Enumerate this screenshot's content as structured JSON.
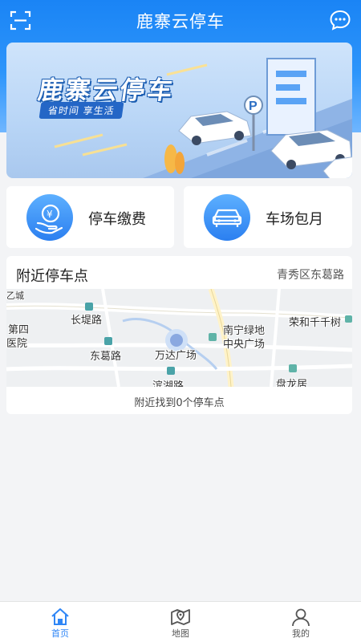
{
  "header": {
    "title": "鹿寨云停车",
    "scan_icon": "scan-icon",
    "message_icon": "message-icon"
  },
  "banner": {
    "title": "鹿寨云停车",
    "slogan": "省时间 享生活",
    "sign_letter": "P"
  },
  "quick_actions": [
    {
      "label": "停车缴费",
      "icon": "yen-hand-icon"
    },
    {
      "label": "车场包月",
      "icon": "car-icon"
    }
  ],
  "nearby": {
    "title": "附近停车点",
    "district": "青秀区东葛路",
    "found_text": "附近找到0个停车点",
    "map_labels": {
      "l1": "长堤路",
      "l2": "东葛路",
      "l3": "万达广场",
      "l4": "南宁绿地",
      "l5": "中央广场",
      "l6": "荣和千千树",
      "l7": "第四",
      "l8": "医院",
      "l9": "盘龙居",
      "l10": "滨湖路",
      "l11": "乙城"
    }
  },
  "tabbar": {
    "tabs": [
      {
        "label": "首页",
        "icon": "home-icon",
        "active": true
      },
      {
        "label": "地图",
        "icon": "map-icon",
        "active": false
      },
      {
        "label": "我的",
        "icon": "user-icon",
        "active": false
      }
    ]
  },
  "colors": {
    "brand_blue": "#1a84f5",
    "active_tab": "#2f86f6"
  }
}
